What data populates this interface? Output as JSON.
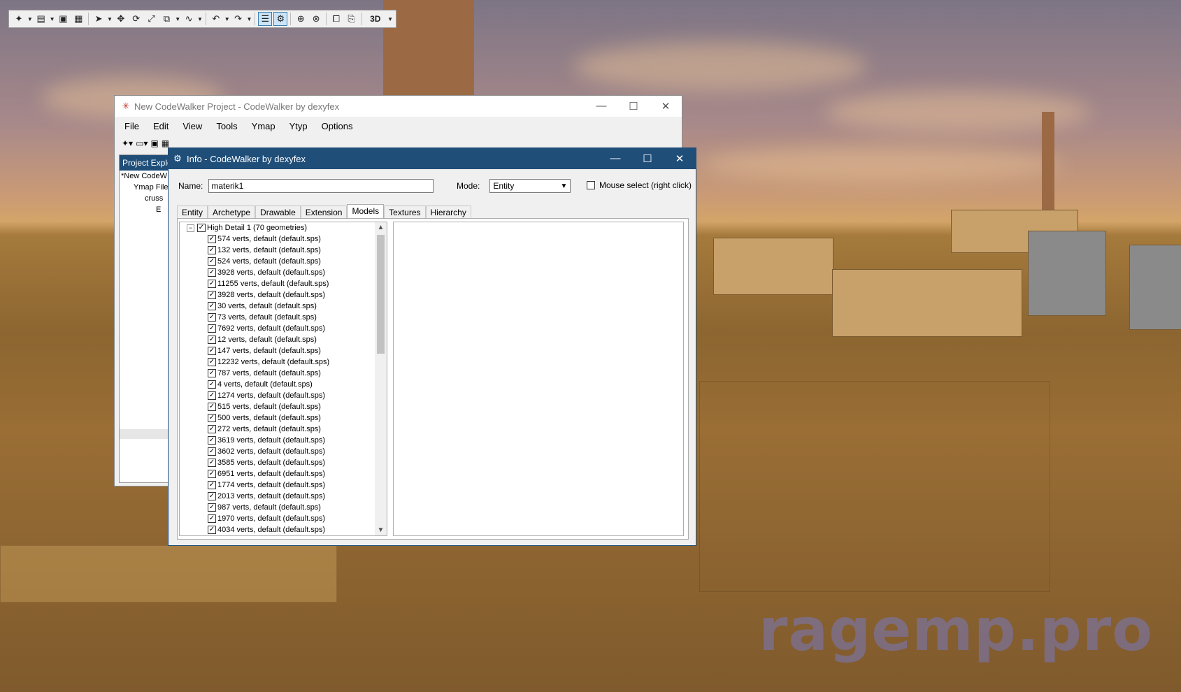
{
  "project_window": {
    "title": "New CodeWalker Project - CodeWalker by dexyfex",
    "menu": [
      "File",
      "Edit",
      "View",
      "Tools",
      "Ymap",
      "Ytyp",
      "Options"
    ],
    "explorer_header": "Project Explo",
    "tree": [
      "*New CodeW",
      "Ymap File",
      "cruss",
      "E"
    ]
  },
  "info_window": {
    "title": "Info - CodeWalker by dexyfex",
    "name_label": "Name:",
    "name_value": "materik1",
    "mode_label": "Mode:",
    "mode_value": "Entity",
    "mouse_select_label": "Mouse select (right click)",
    "tabs": [
      "Entity",
      "Archetype",
      "Drawable",
      "Extension",
      "Models",
      "Textures",
      "Hierarchy"
    ],
    "active_tab": "Models",
    "root_node": "High Detail 1 (70 geometries)",
    "geometries": [
      "574 verts, default (default.sps)",
      "132 verts, default (default.sps)",
      "524 verts, default (default.sps)",
      "3928 verts, default (default.sps)",
      "11255 verts, default (default.sps)",
      "3928 verts, default (default.sps)",
      "30 verts, default (default.sps)",
      "73 verts, default (default.sps)",
      "7692 verts, default (default.sps)",
      "12 verts, default (default.sps)",
      "147 verts, default (default.sps)",
      "12232 verts, default (default.sps)",
      "787 verts, default (default.sps)",
      "4 verts, default (default.sps)",
      "1274 verts, default (default.sps)",
      "515 verts, default (default.sps)",
      "500 verts, default (default.sps)",
      "272 verts, default (default.sps)",
      "3619 verts, default (default.sps)",
      "3602 verts, default (default.sps)",
      "3585 verts, default (default.sps)",
      "6951 verts, default (default.sps)",
      "1774 verts, default (default.sps)",
      "2013 verts, default (default.sps)",
      "987 verts, default (default.sps)",
      "1970 verts, default (default.sps)",
      "4034 verts, default (default.sps)"
    ]
  },
  "toolbar": {
    "view_mode": "3D"
  },
  "watermark": "ragemp.pro",
  "colors": {
    "title_bar": "#1f4e79",
    "tab_active": "#ffffff"
  }
}
